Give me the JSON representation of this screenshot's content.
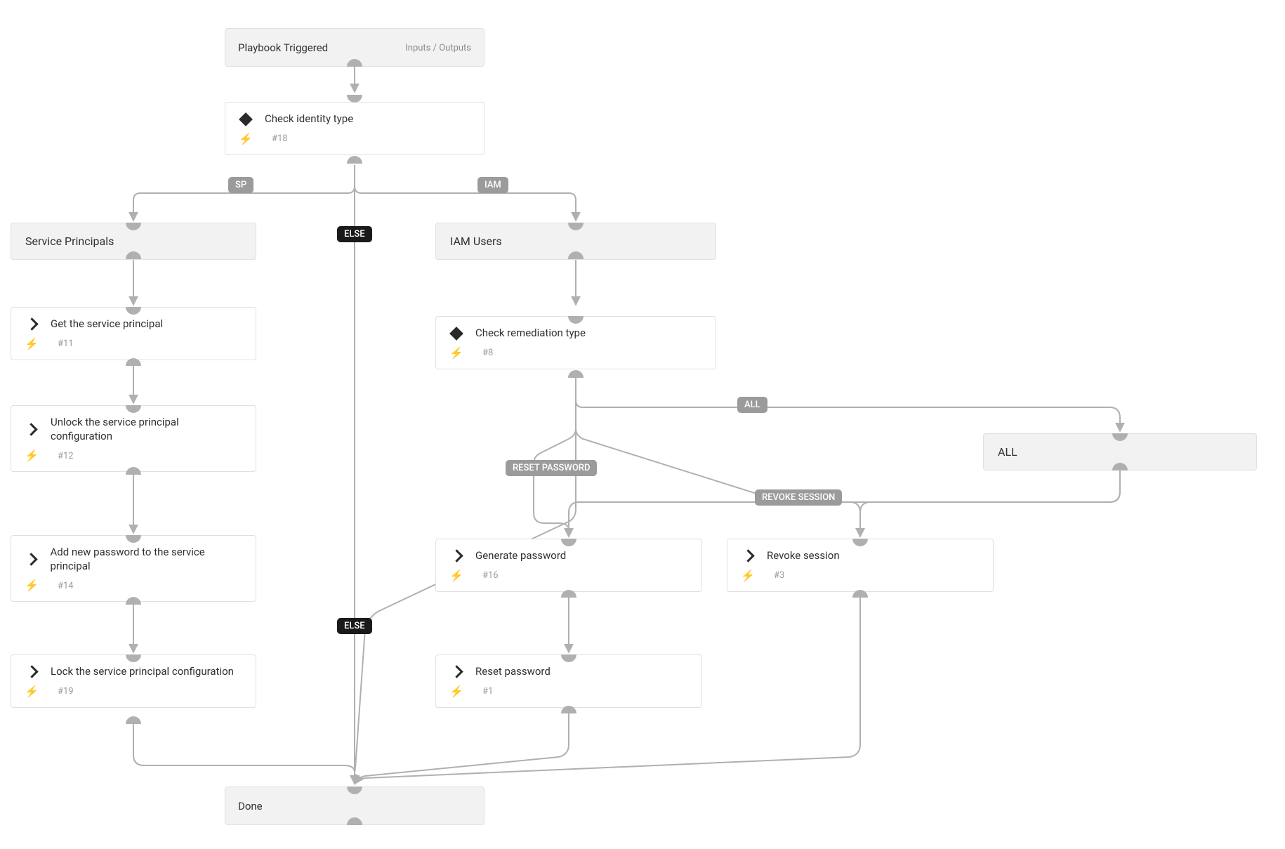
{
  "nodes": {
    "trigger": {
      "title": "Playbook Triggered",
      "meta_link": "Inputs / Outputs"
    },
    "check_identity": {
      "title": "Check identity type",
      "step": "#18"
    },
    "sp_header": {
      "title": "Service Principals"
    },
    "iam_header": {
      "title": "IAM Users"
    },
    "get_sp": {
      "title": "Get the service principal",
      "step": "#11"
    },
    "unlock_sp": {
      "title": "Unlock the service principal configuration",
      "step": "#12"
    },
    "add_pw_sp": {
      "title": "Add new password to the service principal",
      "step": "#14"
    },
    "lock_sp": {
      "title": "Lock the service principal configuration",
      "step": "#19"
    },
    "check_remediation": {
      "title": "Check remediation type",
      "step": "#8"
    },
    "all_header": {
      "title": "ALL"
    },
    "gen_pw": {
      "title": "Generate password",
      "step": "#16"
    },
    "reset_pw": {
      "title": "Reset password",
      "step": "#1"
    },
    "revoke": {
      "title": "Revoke session",
      "step": "#3"
    },
    "done": {
      "title": "Done"
    }
  },
  "edge_labels": {
    "sp": "SP",
    "iam": "IAM",
    "else1": "ELSE",
    "else2": "ELSE",
    "reset_password": "RESET PASSWORD",
    "revoke_session": "REVOKE SESSION",
    "all": "ALL"
  }
}
